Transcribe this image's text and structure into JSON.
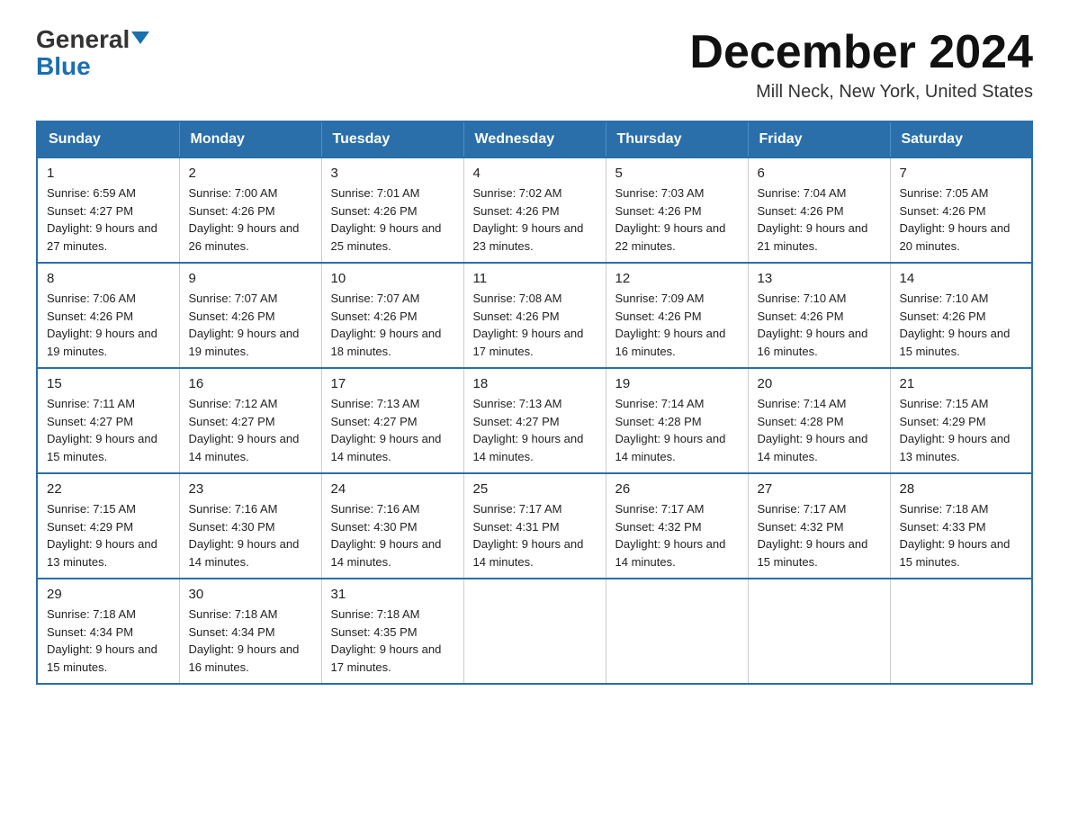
{
  "logo": {
    "top": "General",
    "bottom": "Blue"
  },
  "title": "December 2024",
  "location": "Mill Neck, New York, United States",
  "days_of_week": [
    "Sunday",
    "Monday",
    "Tuesday",
    "Wednesday",
    "Thursday",
    "Friday",
    "Saturday"
  ],
  "weeks": [
    [
      {
        "day": "1",
        "sunrise": "6:59 AM",
        "sunset": "4:27 PM",
        "daylight": "9 hours and 27 minutes."
      },
      {
        "day": "2",
        "sunrise": "7:00 AM",
        "sunset": "4:26 PM",
        "daylight": "9 hours and 26 minutes."
      },
      {
        "day": "3",
        "sunrise": "7:01 AM",
        "sunset": "4:26 PM",
        "daylight": "9 hours and 25 minutes."
      },
      {
        "day": "4",
        "sunrise": "7:02 AM",
        "sunset": "4:26 PM",
        "daylight": "9 hours and 23 minutes."
      },
      {
        "day": "5",
        "sunrise": "7:03 AM",
        "sunset": "4:26 PM",
        "daylight": "9 hours and 22 minutes."
      },
      {
        "day": "6",
        "sunrise": "7:04 AM",
        "sunset": "4:26 PM",
        "daylight": "9 hours and 21 minutes."
      },
      {
        "day": "7",
        "sunrise": "7:05 AM",
        "sunset": "4:26 PM",
        "daylight": "9 hours and 20 minutes."
      }
    ],
    [
      {
        "day": "8",
        "sunrise": "7:06 AM",
        "sunset": "4:26 PM",
        "daylight": "9 hours and 19 minutes."
      },
      {
        "day": "9",
        "sunrise": "7:07 AM",
        "sunset": "4:26 PM",
        "daylight": "9 hours and 19 minutes."
      },
      {
        "day": "10",
        "sunrise": "7:07 AM",
        "sunset": "4:26 PM",
        "daylight": "9 hours and 18 minutes."
      },
      {
        "day": "11",
        "sunrise": "7:08 AM",
        "sunset": "4:26 PM",
        "daylight": "9 hours and 17 minutes."
      },
      {
        "day": "12",
        "sunrise": "7:09 AM",
        "sunset": "4:26 PM",
        "daylight": "9 hours and 16 minutes."
      },
      {
        "day": "13",
        "sunrise": "7:10 AM",
        "sunset": "4:26 PM",
        "daylight": "9 hours and 16 minutes."
      },
      {
        "day": "14",
        "sunrise": "7:10 AM",
        "sunset": "4:26 PM",
        "daylight": "9 hours and 15 minutes."
      }
    ],
    [
      {
        "day": "15",
        "sunrise": "7:11 AM",
        "sunset": "4:27 PM",
        "daylight": "9 hours and 15 minutes."
      },
      {
        "day": "16",
        "sunrise": "7:12 AM",
        "sunset": "4:27 PM",
        "daylight": "9 hours and 14 minutes."
      },
      {
        "day": "17",
        "sunrise": "7:13 AM",
        "sunset": "4:27 PM",
        "daylight": "9 hours and 14 minutes."
      },
      {
        "day": "18",
        "sunrise": "7:13 AM",
        "sunset": "4:27 PM",
        "daylight": "9 hours and 14 minutes."
      },
      {
        "day": "19",
        "sunrise": "7:14 AM",
        "sunset": "4:28 PM",
        "daylight": "9 hours and 14 minutes."
      },
      {
        "day": "20",
        "sunrise": "7:14 AM",
        "sunset": "4:28 PM",
        "daylight": "9 hours and 14 minutes."
      },
      {
        "day": "21",
        "sunrise": "7:15 AM",
        "sunset": "4:29 PM",
        "daylight": "9 hours and 13 minutes."
      }
    ],
    [
      {
        "day": "22",
        "sunrise": "7:15 AM",
        "sunset": "4:29 PM",
        "daylight": "9 hours and 13 minutes."
      },
      {
        "day": "23",
        "sunrise": "7:16 AM",
        "sunset": "4:30 PM",
        "daylight": "9 hours and 14 minutes."
      },
      {
        "day": "24",
        "sunrise": "7:16 AM",
        "sunset": "4:30 PM",
        "daylight": "9 hours and 14 minutes."
      },
      {
        "day": "25",
        "sunrise": "7:17 AM",
        "sunset": "4:31 PM",
        "daylight": "9 hours and 14 minutes."
      },
      {
        "day": "26",
        "sunrise": "7:17 AM",
        "sunset": "4:32 PM",
        "daylight": "9 hours and 14 minutes."
      },
      {
        "day": "27",
        "sunrise": "7:17 AM",
        "sunset": "4:32 PM",
        "daylight": "9 hours and 15 minutes."
      },
      {
        "day": "28",
        "sunrise": "7:18 AM",
        "sunset": "4:33 PM",
        "daylight": "9 hours and 15 minutes."
      }
    ],
    [
      {
        "day": "29",
        "sunrise": "7:18 AM",
        "sunset": "4:34 PM",
        "daylight": "9 hours and 15 minutes."
      },
      {
        "day": "30",
        "sunrise": "7:18 AM",
        "sunset": "4:34 PM",
        "daylight": "9 hours and 16 minutes."
      },
      {
        "day": "31",
        "sunrise": "7:18 AM",
        "sunset": "4:35 PM",
        "daylight": "9 hours and 17 minutes."
      },
      null,
      null,
      null,
      null
    ]
  ]
}
